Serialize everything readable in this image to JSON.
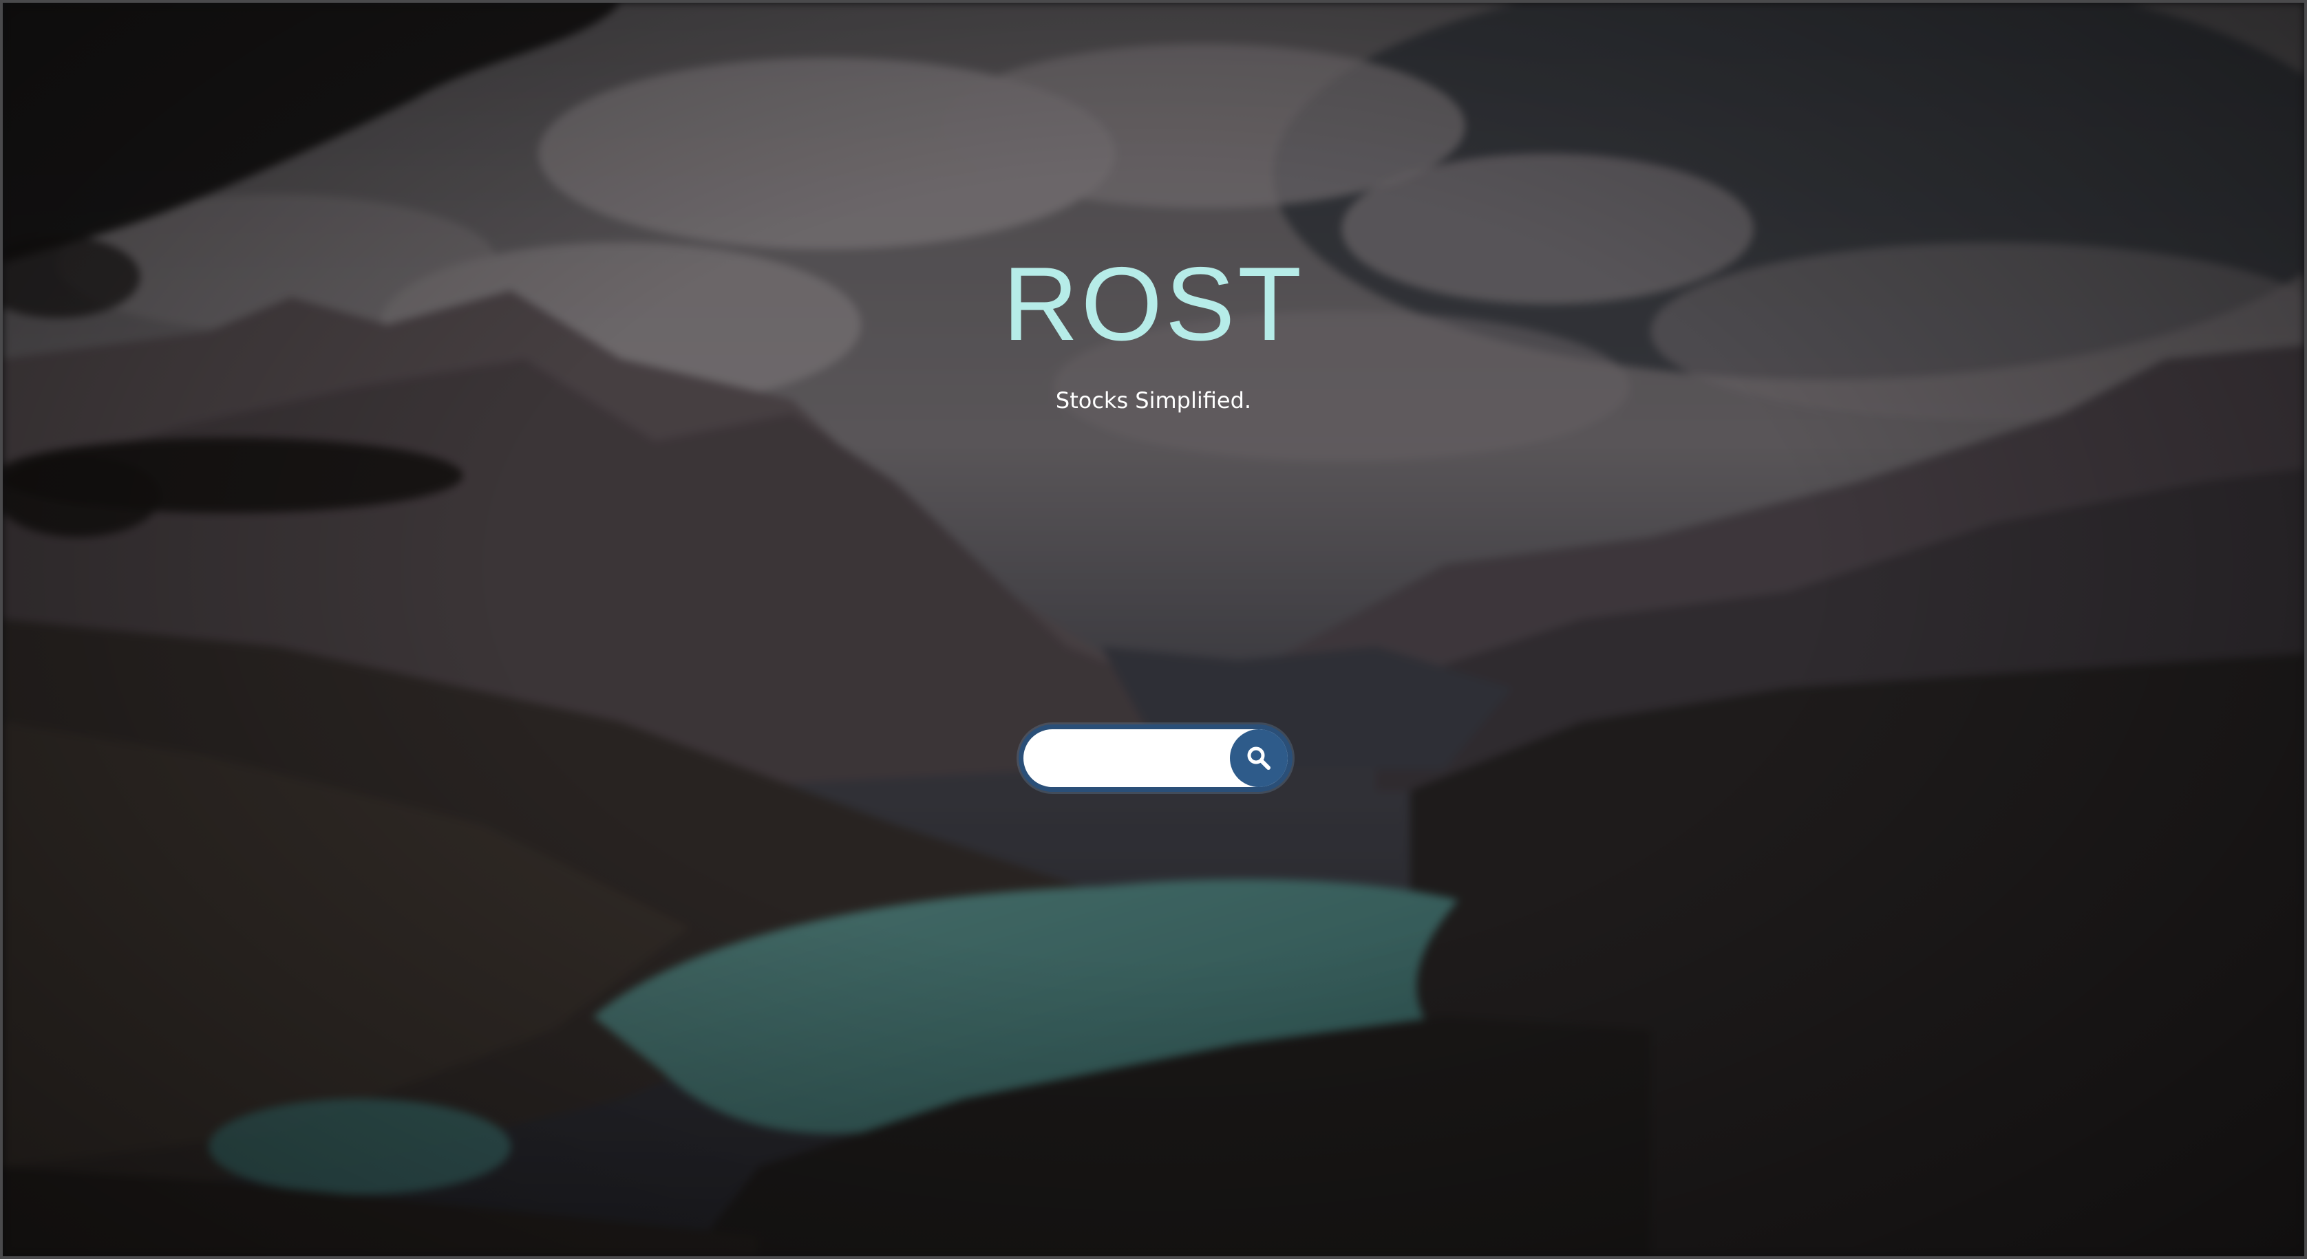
{
  "hero": {
    "title": "ROST",
    "tagline": "Stocks Simplified."
  },
  "search": {
    "value": "",
    "placeholder": "",
    "button_icon": "search-icon"
  },
  "colors": {
    "title": "#b6ece8",
    "search_border": "#2a4f78",
    "search_button": "#2e5b8a"
  },
  "background": {
    "icon": "mountain-lake-landscape-photo"
  }
}
